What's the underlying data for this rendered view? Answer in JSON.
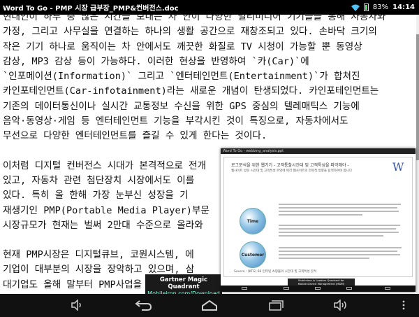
{
  "status_bar": {
    "app_title": "Word To Go - PMP 시장 급부장_PMP&컨버전스.doc",
    "battery": "83%",
    "time": "14:14"
  },
  "document": {
    "paragraphs": [
      {
        "lines": [
          "현대인이 하루 중 많은 시간을 보내는 차 안이 다양한 멀티미디어 기기들을 통해 자동차와",
          "가정, 그리고 사무실을 연결하는 하나의 생활 공간으로 재창조되고 있다. 손바닥 크기의",
          "작은 기기 하나로 움직이는 차 안에서도 깨끗한 화질로 TV 시청이 가능할 뿐 동영상",
          "감상, MP3 감상 등이 가능하다. 이러한 현상을 반영하여 `카(Car)`에",
          "`인포메이션(Information)` 그리고 `엔터테인먼트(Entertainment)`가 합쳐진",
          "카인포테인먼트(Car-infotainment)라는 새로운 개념이 탄생되었다. 카인포테인먼트는",
          "기존의 데이터통신이나 실시간 교통정보 수신을 위한 GPS 중심의 텔레매틱스 기능에",
          "음악·동영상·게임 등 엔터테인먼트 기능을 부각시킨 것이 특징으로, 자동차에서도",
          "무선으로 다양한 엔터테인먼트를 즐길 수 있게 한다는 것이다."
        ]
      },
      {
        "lines": [
          "이처럼 디지털 컨버전스 시대가 본격적으로 전개",
          "있고, 자동차 관련 첨단장치 시장에서도 이를",
          "있다. 특히 올 한해 가장 눈부신 성장을 기",
          "재생기인 PMP(Portable Media Player)부문",
          "시장규모가 현재는 벌써 2만대 수준으로 올라와"
        ]
      },
      {
        "lines": [
          "현재 PMP시장은 디지털큐브, 코원시스템, 에",
          "기업이 대부분의 시장을 장악하고 있으며, 삼",
          "대기업도 올해 말부터 PMP사업을 시작할 계"
        ]
      }
    ]
  },
  "ad_banner": {
    "title": "Gartner Magic Quadrant",
    "subtitle": "Mobileiron.com/Download"
  },
  "recent_thumbnail": {
    "titlebar": "Word To Go - webbing_analysis.ppt",
    "heading": "로그분석을 위한 웹기기 - 고객통찰시간대 및 고객특성을 파악해야 -",
    "subheading": "웹사이트 방문 시간대 및 고객특성 파악에 따라 웹사이트의 전략적 방향을 탐색하여야 합니다",
    "logo_letter": "W",
    "circle_time": "Time",
    "circle_customer": "Customer",
    "source": "Source : [KTG] 66 인터넷 쇼핑몰의 시간대 및 고객특성 분석",
    "ad_line1": "MobileIron is Leaders Quadrant for",
    "ad_line2": "Mobile Device Management (MDM)"
  },
  "nav_bar": {
    "icons": [
      "volume-down-icon",
      "back-icon",
      "home-icon",
      "recent-apps-icon",
      "volume-up-icon",
      "menu-icon"
    ]
  }
}
